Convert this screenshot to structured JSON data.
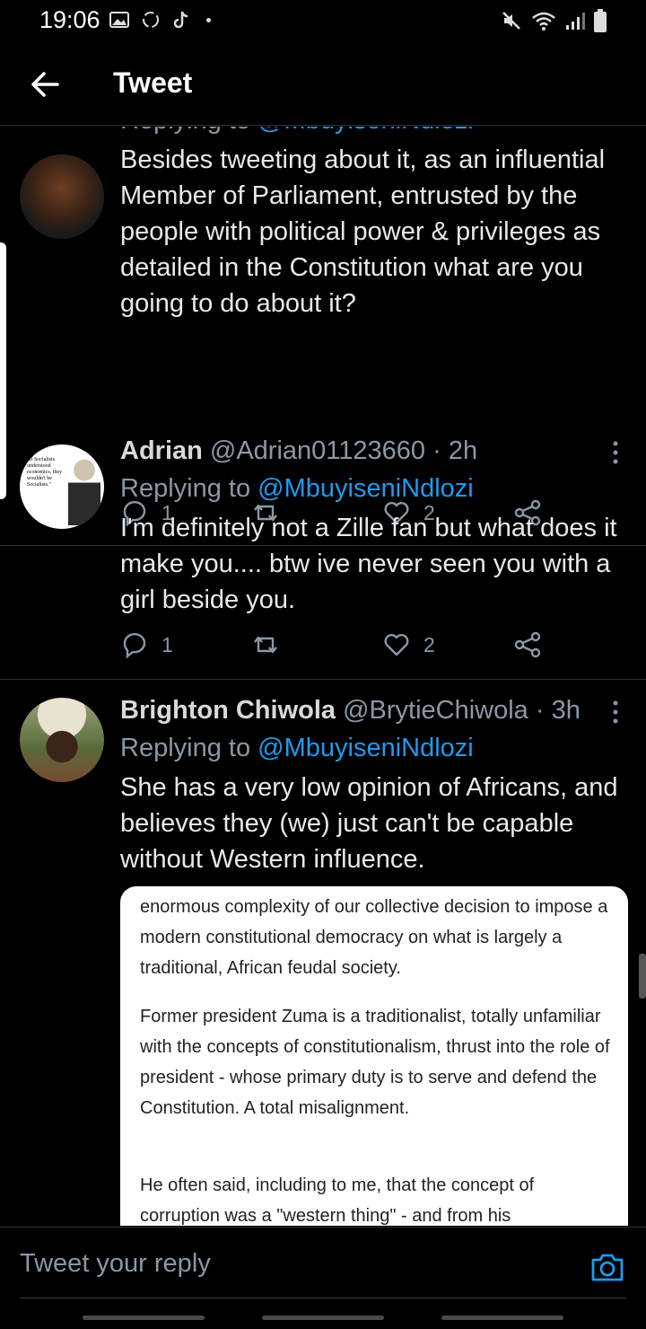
{
  "status_bar": {
    "time": "19:06"
  },
  "header": {
    "title": "Tweet"
  },
  "tweets": [
    {
      "replying_prefix": "Replying to ",
      "replying_to": "@MbuyiseniNdlozi",
      "text": "Besides tweeting about it, as an influential Member of Parliament, entrusted by the people with political power & privileges as detailed in the Constitution what are you going to do about it?",
      "replies": "1",
      "retweets": "",
      "likes": "2"
    },
    {
      "name": "Adrian",
      "handle_time": " @Adrian01123660 · 2h",
      "replying_prefix": "Replying to ",
      "replying_to": "@MbuyiseniNdlozi",
      "text": "I'm definitely not a Zille fan but what does it make you.... btw ive never seen you with a girl beside you.",
      "replies": "1",
      "retweets": "",
      "likes": "2",
      "avatar_quote": "\"If Socialists understood economics, they wouldn't be Socialists.\""
    },
    {
      "name": "Brighton Chiwola",
      "handle_time": " @BrytieChiwola · 3h",
      "replying_prefix": "Replying to ",
      "replying_to": "@MbuyiseniNdlozi",
      "text": "She has a very low opinion of Africans, and believes they (we) just can't be capable without Western influence.",
      "quoted_paragraphs": [
        "enormous complexity of our collective decision to impose a modern constitutional democracy on what is largely a traditional, African feudal society.",
        "Former president Zuma is a traditionalist, totally unfamiliar with the concepts of constitutionalism, thrust into the role of president - whose primary duty is to serve and defend the Constitution. A total misalignment.",
        "He often said, including to me, that the concept of corruption was a \"western thing\" - and from his"
      ]
    }
  ],
  "reply_bar": {
    "placeholder": "Tweet your reply"
  },
  "colors": {
    "background": "#000000",
    "accent": "#1d9bf0",
    "muted": "#8b98a5",
    "divider": "#2f3336"
  }
}
